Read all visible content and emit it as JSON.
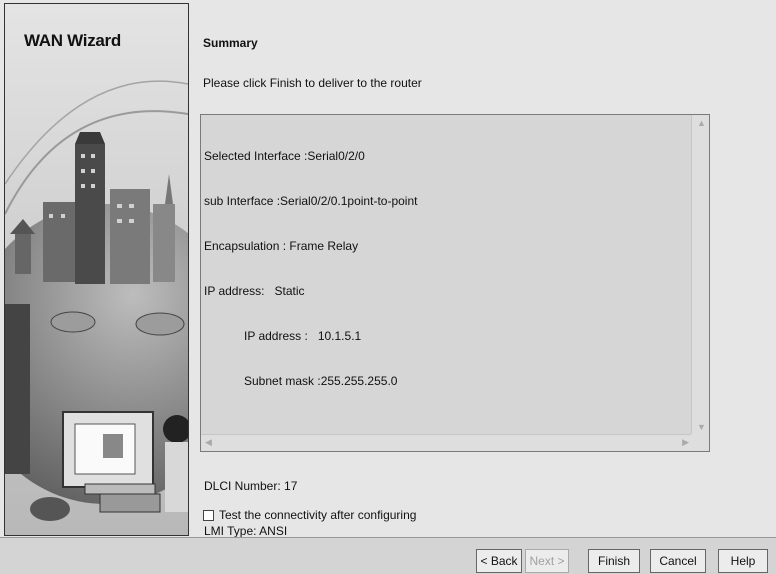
{
  "wizard": {
    "title": "WAN Wizard"
  },
  "summary": {
    "heading": "Summary",
    "instruction": "Please click Finish to deliver to the router",
    "lines": [
      "Selected Interface :Serial0/2/0",
      "sub Interface :Serial0/2/0.1point-to-point",
      "Encapsulation : Frame Relay",
      "IP address:   Static",
      "            IP address :   10.1.5.1",
      "            Subnet mask :255.255.255.0",
      "",
      "",
      "DLCI Number: 17",
      "LMI Type: ANSI"
    ]
  },
  "options": {
    "test_connectivity_label": "Test the connectivity after configuring",
    "test_connectivity_checked": false
  },
  "buttons": {
    "back": "< Back",
    "next": "Next >",
    "finish": "Finish",
    "cancel": "Cancel",
    "help": "Help"
  }
}
